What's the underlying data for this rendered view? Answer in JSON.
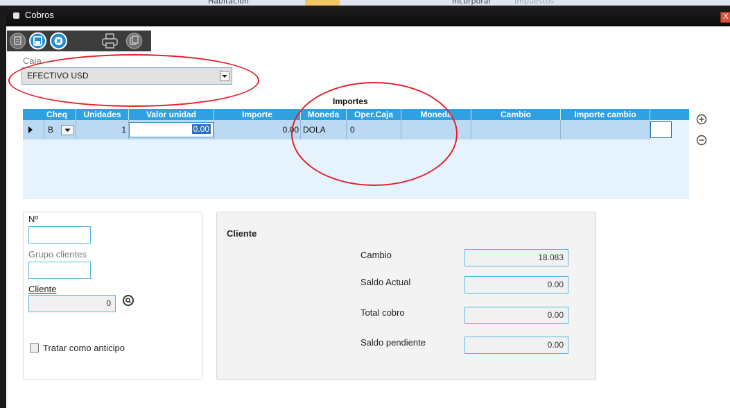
{
  "background_app": {
    "tabs": [
      "Habitación",
      "Incorporar",
      "Impuestos"
    ]
  },
  "window": {
    "title": "Cobros",
    "close_glyph": "X"
  },
  "toolbar": {
    "buttons": [
      {
        "name": "new-icon",
        "enabled": false
      },
      {
        "name": "save-icon",
        "enabled": true
      },
      {
        "name": "cancel-icon",
        "enabled": true
      },
      {
        "name": "print-icon",
        "enabled": false
      },
      {
        "name": "copy-icon",
        "enabled": false
      }
    ]
  },
  "caja": {
    "label": "Caja",
    "value": "EFECTIVO USD"
  },
  "grid": {
    "group_header": "Importes",
    "columns": [
      "Cheq",
      "Unidades",
      "Valor unidad",
      "Importe",
      "Moneda",
      "Oper.Caja",
      "Moneda",
      "Cambio",
      "Importe cambio"
    ],
    "row": {
      "cheq": "B",
      "unidades": "1",
      "valor_unidad": "0.00",
      "importe": "0.00",
      "moneda": "DOLA",
      "oper_caja": "0",
      "moneda2": "",
      "cambio": "",
      "importe_cambio": ""
    },
    "add_icon": "plus-circle-icon",
    "remove_icon": "minus-circle-icon"
  },
  "left_panel": {
    "numero_label": "Nº",
    "numero_value": "",
    "grupo_label": "Grupo clientes",
    "grupo_value": "",
    "cliente_label": "Cliente",
    "cliente_value": "0",
    "anticipo_label": "Tratar como anticipo",
    "anticipo_checked": false
  },
  "right_panel": {
    "title": "Cliente",
    "cambio_label": "Cambio",
    "cambio_value": "18.083",
    "saldo_actual_label": "Saldo Actual",
    "saldo_actual_value": "0.00",
    "total_cobro_label": "Total cobro",
    "total_cobro_value": "0.00",
    "saldo_pendiente_label": "Saldo pendiente",
    "saldo_pendiente_value": "0.00"
  },
  "colors": {
    "accent": "#2fa1e0",
    "annotation": "#e3202a"
  }
}
